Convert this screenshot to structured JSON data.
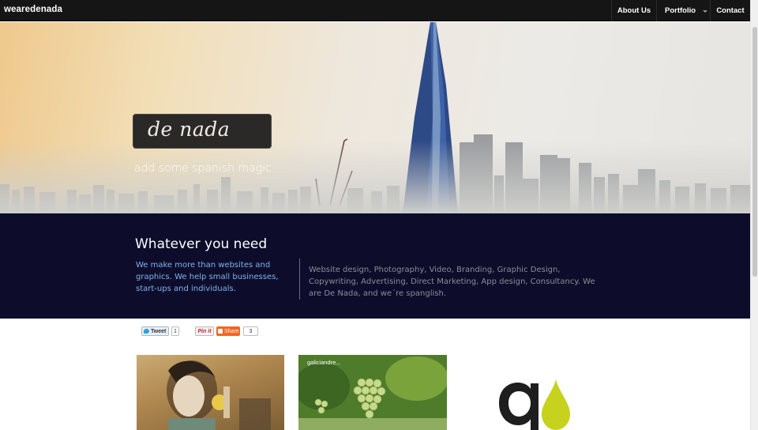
{
  "navbar": {
    "brand": "wearedenada",
    "items": [
      {
        "label": "About Us"
      },
      {
        "label": "Portfolio"
      },
      {
        "label": "Contact"
      }
    ]
  },
  "hero": {
    "logo_text": "de nada",
    "tagline": "add some spanish magic"
  },
  "band": {
    "title": "Whatever you need",
    "intro": "We make more than websites and graphics. We help small businesses, start-ups and individuals.",
    "services": "Website design, Photography, Video, Branding, Graphic Design, Copywriting, Advertising, Direct Marketing, App design, Consultancy. We are De Nada, and we´re spanglish."
  },
  "social": {
    "tweet_label": "Tweet",
    "tweet_count": "1",
    "pin_label": "Pin it",
    "share_label": "Share",
    "share_count": "3"
  },
  "portfolio": {
    "thumb2_caption": "galiciandre..."
  },
  "colors": {
    "navbar": "#151515",
    "band": "#0d0d2b",
    "band_link": "#7fb2ee",
    "share_orange": "#f26522",
    "logo_drop": "#c6d21e"
  }
}
